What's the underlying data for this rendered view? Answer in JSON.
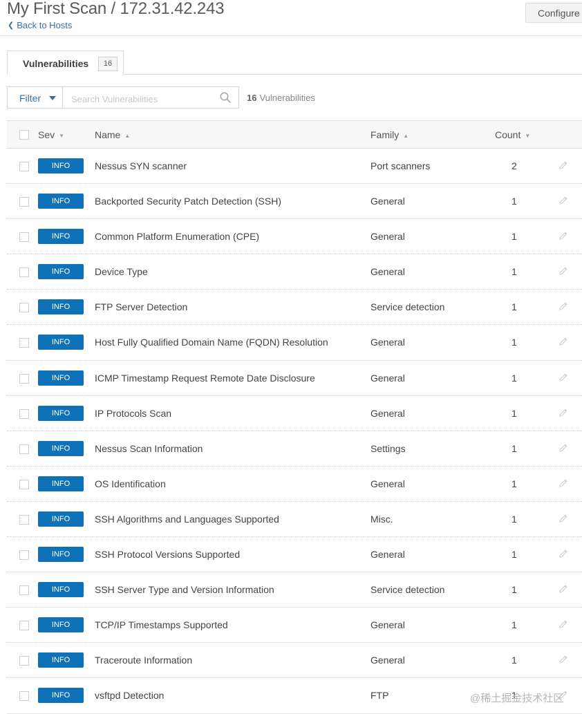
{
  "header": {
    "title": "My First Scan / 172.31.42.243",
    "back_label": "Back to Hosts",
    "configure_label": "Configure"
  },
  "tabs": [
    {
      "label": "Vulnerabilities",
      "count": "16",
      "active": true
    }
  ],
  "toolbar": {
    "filter_label": "Filter",
    "search_placeholder": "Search Vulnerabilities",
    "search_value": "",
    "result_count": "16",
    "result_label": "Vulnerabilities"
  },
  "table": {
    "columns": {
      "sev": "Sev",
      "name": "Name",
      "family": "Family",
      "count": "Count"
    },
    "sort_indicators": {
      "sev": "▼",
      "name": "▲",
      "family": "▲",
      "count": "▼"
    },
    "rows": [
      {
        "sev": "INFO",
        "name": "Nessus SYN scanner",
        "family": "Port scanners",
        "count": "2"
      },
      {
        "sev": "INFO",
        "name": "Backported Security Patch Detection (SSH)",
        "family": "General",
        "count": "1"
      },
      {
        "sev": "INFO",
        "name": "Common Platform Enumeration (CPE)",
        "family": "General",
        "count": "1"
      },
      {
        "sev": "INFO",
        "name": "Device Type",
        "family": "General",
        "count": "1"
      },
      {
        "sev": "INFO",
        "name": "FTP Server Detection",
        "family": "Service detection",
        "count": "1"
      },
      {
        "sev": "INFO",
        "name": "Host Fully Qualified Domain Name (FQDN) Resolution",
        "family": "General",
        "count": "1"
      },
      {
        "sev": "INFO",
        "name": "ICMP Timestamp Request Remote Date Disclosure",
        "family": "General",
        "count": "1"
      },
      {
        "sev": "INFO",
        "name": "IP Protocols Scan",
        "family": "General",
        "count": "1"
      },
      {
        "sev": "INFO",
        "name": "Nessus Scan Information",
        "family": "Settings",
        "count": "1"
      },
      {
        "sev": "INFO",
        "name": "OS Identification",
        "family": "General",
        "count": "1"
      },
      {
        "sev": "INFO",
        "name": "SSH Algorithms and Languages Supported",
        "family": "Misc.",
        "count": "1"
      },
      {
        "sev": "INFO",
        "name": "SSH Protocol Versions Supported",
        "family": "General",
        "count": "1"
      },
      {
        "sev": "INFO",
        "name": "SSH Server Type and Version Information",
        "family": "Service detection",
        "count": "1"
      },
      {
        "sev": "INFO",
        "name": "TCP/IP Timestamps Supported",
        "family": "General",
        "count": "1"
      },
      {
        "sev": "INFO",
        "name": "Traceroute Information",
        "family": "General",
        "count": "1"
      },
      {
        "sev": "INFO",
        "name": "vsftpd Detection",
        "family": "FTP",
        "count": "1"
      }
    ]
  },
  "icons": {
    "back": "chevron-left-icon",
    "search": "search-icon",
    "filter_caret": "caret-down-icon",
    "row_action": "pencil-icon"
  },
  "colors": {
    "info_badge": "#0f71b8",
    "link": "#3a6f9a"
  },
  "watermark": "@稀土掘金技术社区"
}
